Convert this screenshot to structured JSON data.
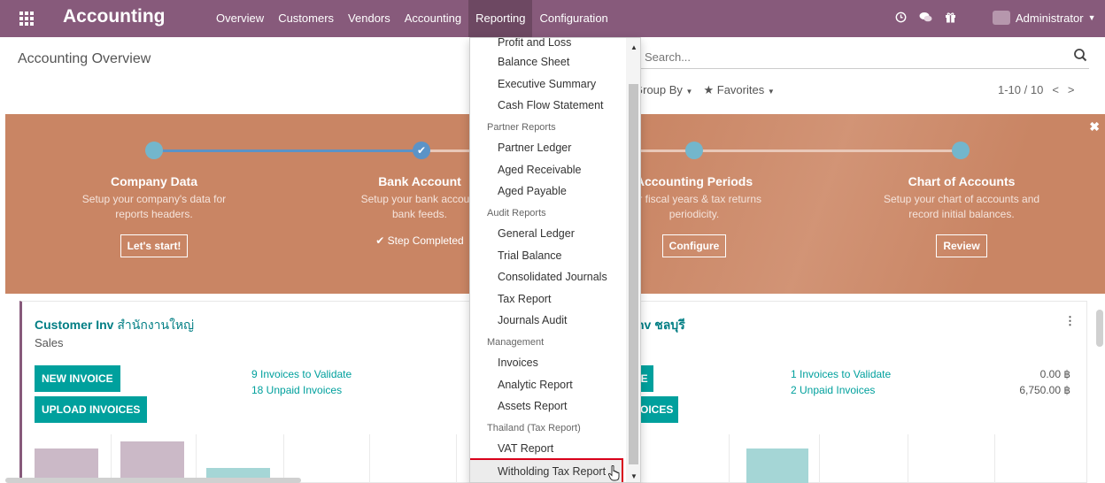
{
  "navbar": {
    "brand": "Accounting",
    "menu": [
      "Overview",
      "Customers",
      "Vendors",
      "Accounting",
      "Reporting",
      "Configuration"
    ],
    "active_menu": "Reporting",
    "user": "Administrator",
    "icons": [
      "clock-icon",
      "chat-icon",
      "gift-icon"
    ]
  },
  "control_panel": {
    "title": "Accounting Overview",
    "search_placeholder": "Search...",
    "group_by": "Group By",
    "favorites": "Favorites",
    "pager": "1-10 / 10"
  },
  "banner": {
    "steps": [
      {
        "title": "Company Data",
        "desc1": "Setup your company's data for",
        "desc2": "reports headers.",
        "button": "Let's start!"
      },
      {
        "title": "Bank Account",
        "desc1": "Setup your bank account",
        "desc2": "bank feeds.",
        "completed": "Step Completed"
      },
      {
        "title": "Accounting Periods",
        "desc1": "our fiscal years & tax returns",
        "desc2": "periodicity.",
        "button": "Configure"
      },
      {
        "title": "Chart of Accounts",
        "desc1": "Setup your chart of accounts and",
        "desc2": "record initial balances.",
        "button": "Review"
      }
    ]
  },
  "cards": {
    "left": {
      "title": "Customer Inv",
      "title_th": "สำนักงานใหญ่",
      "subtitle": "Sales",
      "new_invoice": "NEW INVOICE",
      "upload_invoices": "UPLOAD INVOICES",
      "link1": "9 Invoices to Validate",
      "link2": "18 Unpaid Invoices"
    },
    "right": {
      "title": "nv ชลบุรี",
      "btn1": "CE",
      "btn2": "VOICES",
      "link1": "1 Invoices to Validate",
      "link2": "2 Unpaid Invoices",
      "amount1": "0.00 ฿",
      "amount2": "6,750.00 ฿"
    }
  },
  "dropdown": {
    "partial_top": "Profit and Loss",
    "items": [
      {
        "type": "item",
        "label": "Balance Sheet"
      },
      {
        "type": "item",
        "label": "Executive Summary"
      },
      {
        "type": "item",
        "label": "Cash Flow Statement"
      },
      {
        "type": "header",
        "label": "Partner Reports"
      },
      {
        "type": "item",
        "label": "Partner Ledger"
      },
      {
        "type": "item",
        "label": "Aged Receivable"
      },
      {
        "type": "item",
        "label": "Aged Payable"
      },
      {
        "type": "header",
        "label": "Audit Reports"
      },
      {
        "type": "item",
        "label": "General Ledger"
      },
      {
        "type": "item",
        "label": "Trial Balance"
      },
      {
        "type": "item",
        "label": "Consolidated Journals"
      },
      {
        "type": "item",
        "label": "Tax Report"
      },
      {
        "type": "item",
        "label": "Journals Audit"
      },
      {
        "type": "header",
        "label": "Management"
      },
      {
        "type": "item",
        "label": "Invoices"
      },
      {
        "type": "item",
        "label": "Analytic Report"
      },
      {
        "type": "item",
        "label": "Assets Report"
      },
      {
        "type": "header",
        "label": "Thailand (Tax Report)"
      },
      {
        "type": "item",
        "label": "VAT Report"
      },
      {
        "type": "item",
        "label": "Witholding Tax Report",
        "highlighted": true
      }
    ]
  },
  "colors": {
    "navbar": "#875a7b",
    "banner": "#c98564",
    "accent": "#00a09d",
    "highlight_border": "#d9001b"
  }
}
